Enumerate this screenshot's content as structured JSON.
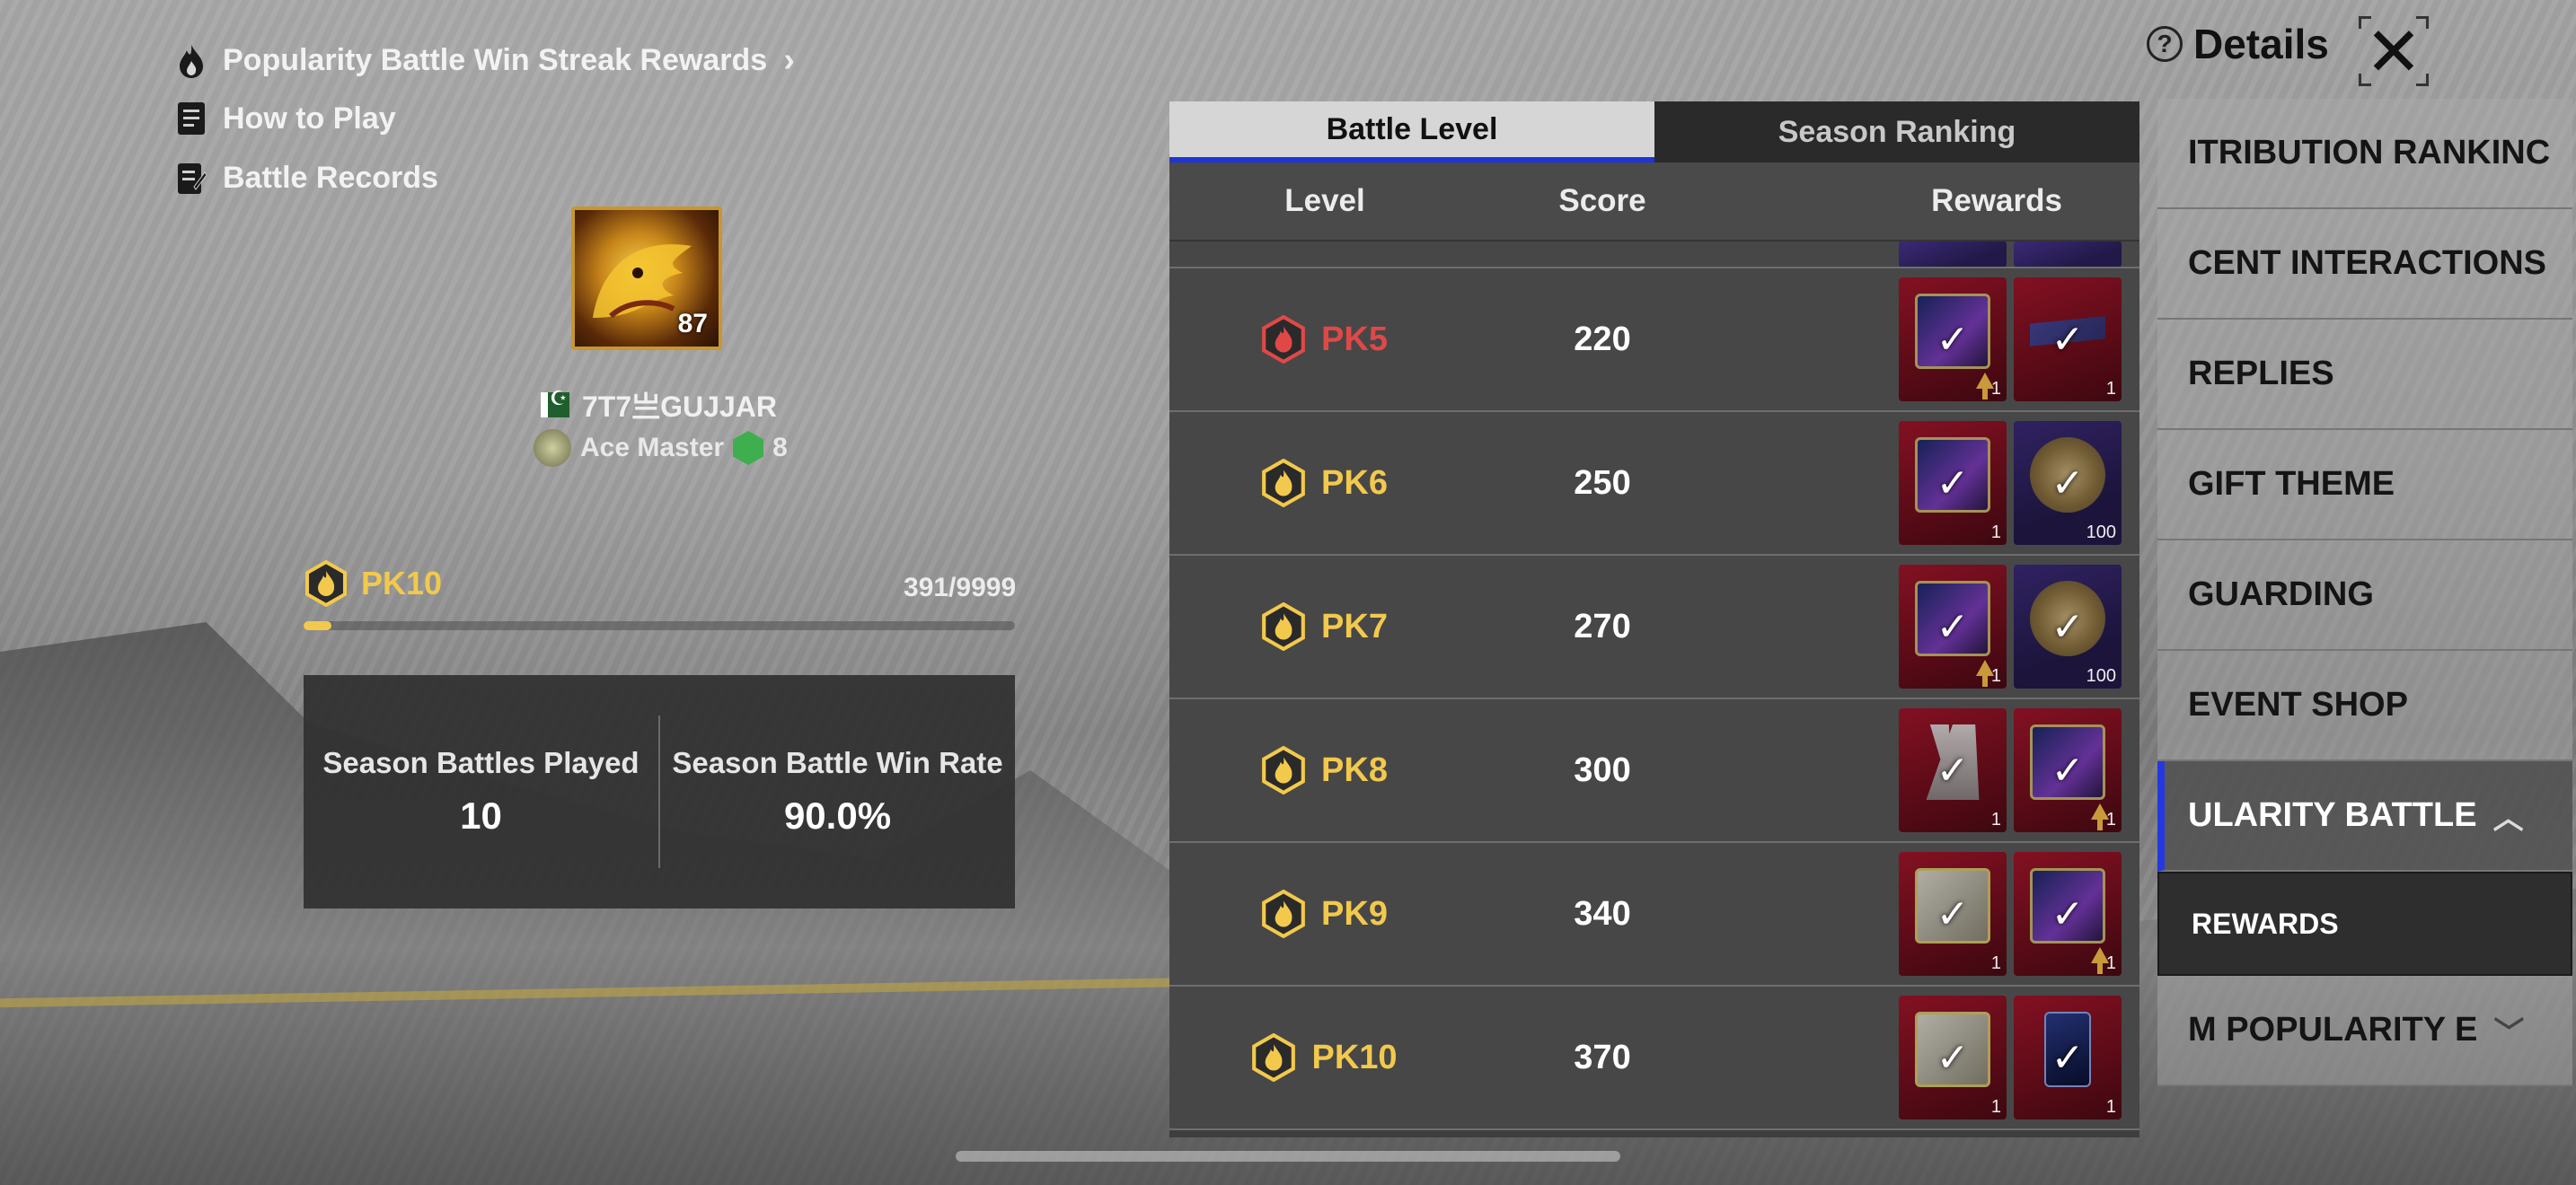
{
  "links": {
    "win_streak": "Popularity Battle Win Streak Rewards",
    "how_to_play": "How to Play",
    "battle_records": "Battle Records"
  },
  "player": {
    "avatar_level": "87",
    "name": "7T7亗GUJJAR",
    "tier": "Ace Master",
    "tier_number": "8"
  },
  "current_level": {
    "label": "PK10",
    "progress_text": "391/9999",
    "progress_fraction": 0.039
  },
  "stats": {
    "played_label": "Season Battles Played",
    "played_value": "10",
    "winrate_label": "Season Battle Win Rate",
    "winrate_value": "90.0%"
  },
  "panel": {
    "tabs": [
      {
        "label": "Battle Level",
        "active": true
      },
      {
        "label": "Season Ranking",
        "active": false
      }
    ],
    "columns": {
      "level": "Level",
      "score": "Score",
      "rewards": "Rewards"
    },
    "rows": [
      {
        "level": "PK5",
        "score": "220",
        "color": "red",
        "rewards": [
          {
            "art": "card",
            "qty": "1",
            "up": true,
            "bg": "red"
          },
          {
            "art": "heli",
            "qty": "1",
            "up": false,
            "bg": "red"
          }
        ]
      },
      {
        "level": "PK6",
        "score": "250",
        "color": "gold",
        "rewards": [
          {
            "art": "card",
            "qty": "1",
            "up": false,
            "bg": "red"
          },
          {
            "art": "coin",
            "qty": "100",
            "up": false,
            "bg": "purple"
          }
        ]
      },
      {
        "level": "PK7",
        "score": "270",
        "color": "gold",
        "rewards": [
          {
            "art": "card",
            "qty": "1",
            "up": true,
            "bg": "red"
          },
          {
            "art": "coin",
            "qty": "100",
            "up": false,
            "bg": "purple"
          }
        ]
      },
      {
        "level": "PK8",
        "score": "300",
        "color": "gold",
        "rewards": [
          {
            "art": "couple",
            "qty": "1",
            "up": false,
            "bg": "red"
          },
          {
            "art": "card",
            "qty": "1",
            "up": true,
            "bg": "red"
          }
        ]
      },
      {
        "level": "PK9",
        "score": "340",
        "color": "gold",
        "rewards": [
          {
            "art": "frame",
            "qty": "1",
            "up": false,
            "bg": "red"
          },
          {
            "art": "card",
            "qty": "1",
            "up": true,
            "bg": "red"
          }
        ]
      },
      {
        "level": "PK10",
        "score": "370",
        "color": "gold",
        "rewards": [
          {
            "art": "frame",
            "qty": "1",
            "up": false,
            "bg": "red"
          },
          {
            "art": "phone",
            "qty": "1",
            "up": false,
            "bg": "red"
          }
        ]
      }
    ]
  },
  "details": {
    "title": "Details",
    "help": "?",
    "close": "✕"
  },
  "menu": [
    {
      "label": "ITRIBUTION RANKINC",
      "active": false
    },
    {
      "label": "CENT INTERACTIONS",
      "active": false
    },
    {
      "label": "REPLIES",
      "active": false
    },
    {
      "label": "GIFT THEME",
      "active": false
    },
    {
      "label": "GUARDING",
      "active": false
    },
    {
      "label": "EVENT SHOP",
      "active": false
    },
    {
      "label": "ULARITY BATTLE",
      "active": true
    },
    {
      "label": "REWARDS",
      "sub": true
    },
    {
      "label": "M POPULARITY E",
      "active": false
    }
  ],
  "colors": {
    "accent_blue": "#1e34d8",
    "gold": "#f2c94c",
    "red": "#e04848"
  },
  "icons": {
    "win_streak": "flame-icon",
    "how_to_play": "document-icon",
    "battle_records": "records-icon"
  }
}
